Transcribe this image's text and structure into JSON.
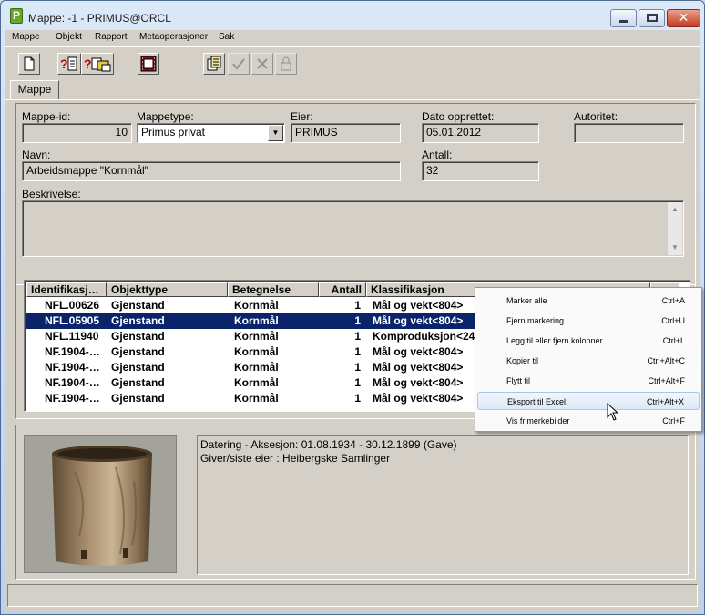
{
  "window": {
    "title": "Mappe: -1 - PRIMUS@ORCL",
    "close_glyph": "✕"
  },
  "menu": [
    "Mappe",
    "Objekt",
    "Rapport",
    "Metaoperasjoner",
    "Sak"
  ],
  "tab": {
    "label": "Mappe"
  },
  "form": {
    "mappe_id_label": "Mappe-id:",
    "mappe_id": "10",
    "mappetype_label": "Mappetype:",
    "mappetype": "Primus privat",
    "eier_label": "Eier:",
    "eier": "PRIMUS",
    "dato_label": "Dato opprettet:",
    "dato": "05.01.2012",
    "autoritet_label": "Autoritet:",
    "autoritet": "",
    "navn_label": "Navn:",
    "navn": "Arbeidsmappe \"Kornmål\"",
    "antall_label": "Antall:",
    "antall": "32",
    "beskrivelse_label": "Beskrivelse:",
    "beskrivelse": ""
  },
  "grid": {
    "columns": [
      "Identifikasj…",
      "Objekttype",
      "Betegnelse",
      "Antall",
      "Klassifikasjon"
    ],
    "rows": [
      [
        "NFL.00626",
        "Gjenstand",
        "Kornmål",
        "1",
        "Mål og vekt<804>"
      ],
      [
        "NFL.05905",
        "Gjenstand",
        "Kornmål",
        "1",
        "Mål og vekt<804>"
      ],
      [
        "NFL.11940",
        "Gjenstand",
        "Kornmål",
        "1",
        "Komproduksjon<243"
      ],
      [
        "NF.1904-…",
        "Gjenstand",
        "Kornmål",
        "1",
        "Mål og vekt<804>"
      ],
      [
        "NF.1904-…",
        "Gjenstand",
        "Kornmål",
        "1",
        "Mål og vekt<804>"
      ],
      [
        "NF.1904-…",
        "Gjenstand",
        "Kornmål",
        "1",
        "Mål og vekt<804>"
      ],
      [
        "NF.1904-…",
        "Gjenstand",
        "Kornmål",
        "1",
        "Mål og vekt<804>"
      ]
    ],
    "selected_row": 1
  },
  "detail": {
    "line1": "Datering - Aksesjon: 01.08.1934 - 30.12.1899  (Gave)",
    "line2": "Giver/siste eier : Heibergske Samlinger"
  },
  "context_menu": [
    {
      "label": "Marker alle",
      "shortcut": "Ctrl+A"
    },
    {
      "label": "Fjern markering",
      "shortcut": "Ctrl+U"
    },
    {
      "label": "Legg til eller fjern kolonner",
      "shortcut": "Ctrl+L"
    },
    {
      "label": "Kopier til",
      "shortcut": "Ctrl+Alt+C"
    },
    {
      "label": "Flytt til",
      "shortcut": "Ctrl+Alt+F"
    },
    {
      "label": "Eksport til Excel",
      "shortcut": "Ctrl+Alt+X"
    },
    {
      "label": "Vis frimerkebilder",
      "shortcut": "Ctrl+F"
    }
  ],
  "context_menu_highlighted": 5,
  "colors": {
    "selection": "#0a246a",
    "face": "#d4d0c8",
    "menu_highlight": "#dde9f8"
  },
  "icons": [
    "new-document-icon",
    "query-icon",
    "query-multi-icon",
    "film-icon",
    "tools-icon",
    "check-icon",
    "cancel-icon",
    "lock-icon"
  ]
}
